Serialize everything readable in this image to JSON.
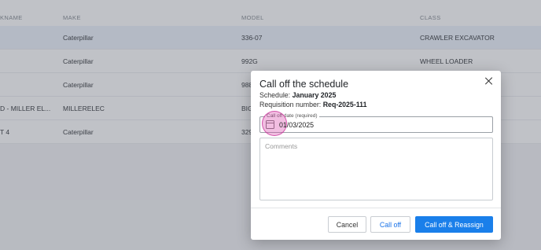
{
  "table": {
    "headers": {
      "nickname": "KNAME",
      "make": "MAKE",
      "model": "MODEL",
      "class": "CLASS"
    },
    "rows": [
      {
        "nickname": "",
        "make": "Caterpillar",
        "model": "336-07",
        "class": "CRAWLER EXCAVATOR"
      },
      {
        "nickname": "",
        "make": "Caterpillar",
        "model": "992G",
        "class": "WHEEL LOADER"
      },
      {
        "nickname": "",
        "make": "Caterpillar",
        "model": "988",
        "class": ""
      },
      {
        "nickname": "D - MILLER EL...",
        "make": "MILLERELEC",
        "model": "BIG",
        "class": ""
      },
      {
        "nickname": "T 4",
        "make": "Caterpillar",
        "model": "329",
        "class": ""
      }
    ]
  },
  "dialog": {
    "title": "Call off the schedule",
    "schedule_label": "Schedule:",
    "schedule_value": "January 2025",
    "requisition_label": "Requisition number:",
    "requisition_value": "Req-2025-111",
    "date_label": "Call off date (required)",
    "date_value": "01/03/2025",
    "comments_placeholder": "Comments",
    "cancel_label": "Cancel",
    "calloff_label": "Call off",
    "reassign_label": "Call off & Reassign"
  },
  "colors": {
    "primary": "#1a7fea",
    "ripple": "#d646aa"
  }
}
